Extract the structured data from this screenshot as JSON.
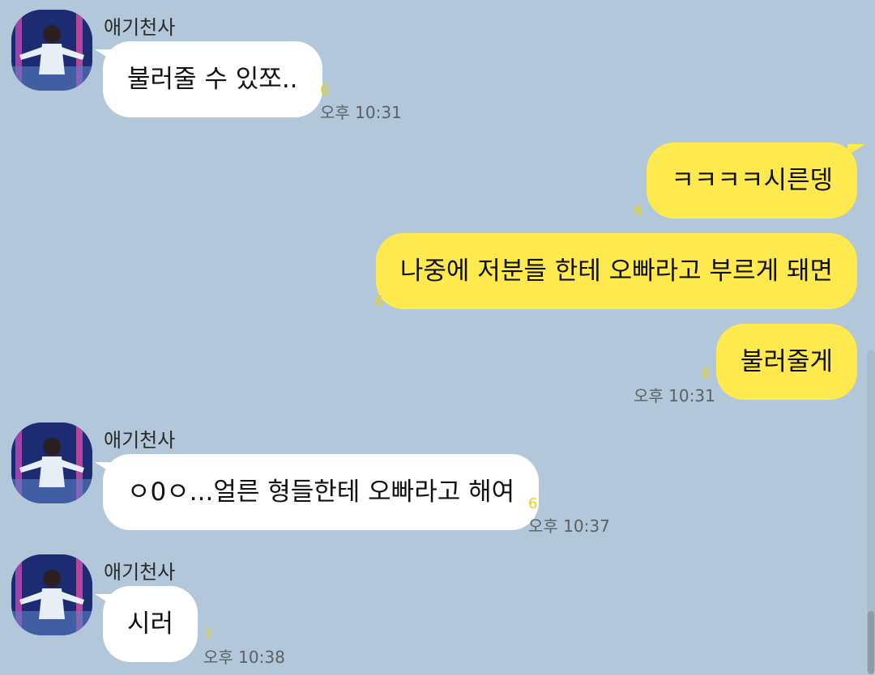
{
  "messages": [
    {
      "type": "incoming",
      "sender": "애기천사",
      "text": "불러줄 수 있쪼..",
      "unread": "6",
      "time": "오후 10:31"
    },
    {
      "type": "outgoing",
      "text": "ㅋㅋㅋㅋ시른뎅",
      "unread": "6"
    },
    {
      "type": "outgoing",
      "text": "나중에 저분들 한테 오빠라고 부르게 돼면",
      "unread": "6"
    },
    {
      "type": "outgoing",
      "text": "불러줄게",
      "unread": "6",
      "time": "오후 10:31"
    },
    {
      "type": "incoming",
      "sender": "애기천사",
      "text": "ㅇ0ㅇ...얼른 형들한테 오빠라고 해여",
      "unread": "6",
      "time": "오후 10:37"
    },
    {
      "type": "incoming",
      "sender": "애기천사",
      "text": "시러",
      "unread": "7",
      "time": "오후 10:38"
    }
  ],
  "colors": {
    "background": "#b2c7da",
    "incoming_bubble": "#ffffff",
    "outgoing_bubble": "#fee94e",
    "unread": "#e6d31a"
  },
  "icons": {
    "avatar": "profile-photo-avatar"
  }
}
